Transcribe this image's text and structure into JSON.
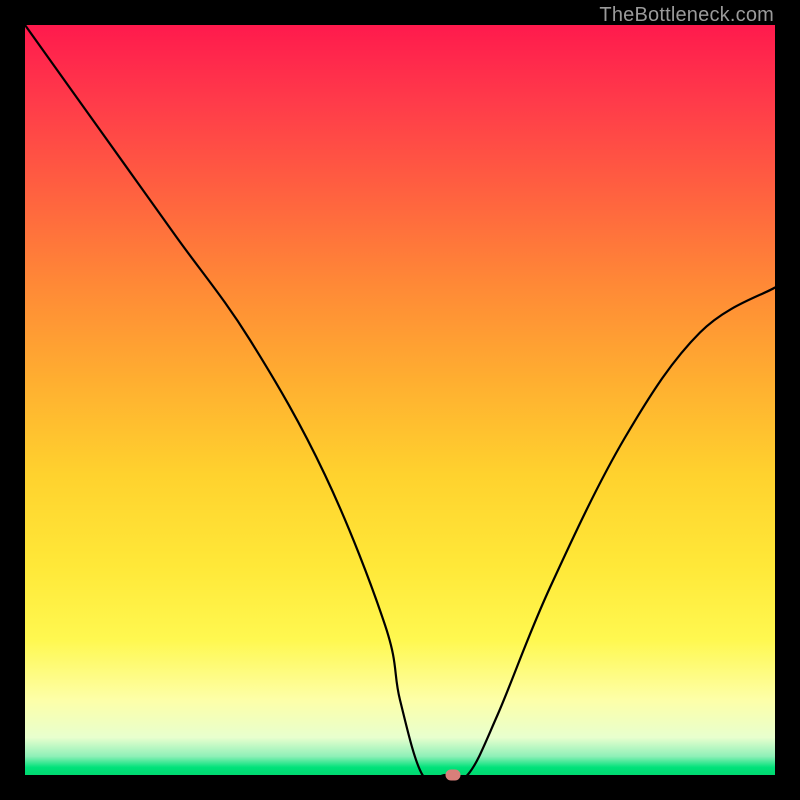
{
  "attribution": "TheBottleneck.com",
  "chart_data": {
    "type": "line",
    "title": "",
    "xlabel": "",
    "ylabel": "",
    "xlim": [
      0,
      100
    ],
    "ylim": [
      0,
      100
    ],
    "grid": false,
    "legend": false,
    "series": [
      {
        "name": "curve",
        "x": [
          0,
          10,
          20,
          30,
          40,
          48,
          50,
          53,
          56,
          59,
          63,
          70,
          80,
          90,
          100
        ],
        "values": [
          100,
          86,
          72,
          58,
          40,
          20,
          10,
          0,
          0,
          0,
          8,
          25,
          45,
          59,
          65
        ]
      }
    ],
    "marker": {
      "x": 57,
      "y": 0
    }
  },
  "colors": {
    "curve": "#000000",
    "marker": "#d87f7a",
    "frame_bg_top": "#ff1a4d",
    "frame_bg_bottom": "#00d870",
    "page_bg": "#000000"
  }
}
